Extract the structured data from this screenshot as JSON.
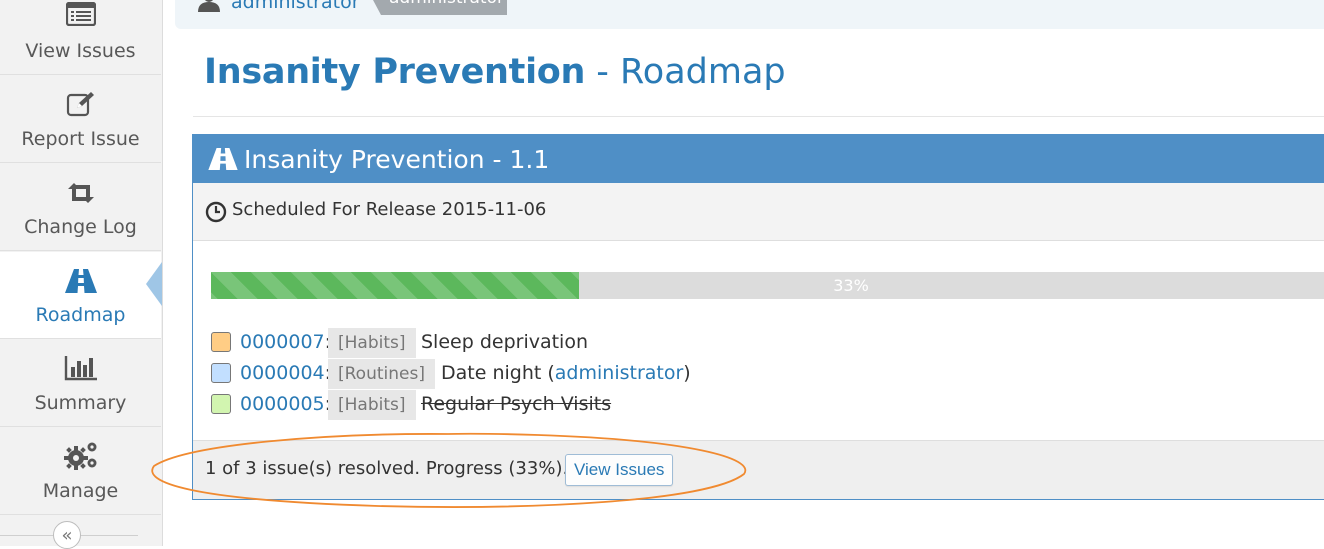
{
  "sidebar": {
    "items": [
      {
        "label": "View Issues",
        "icon": "list-icon"
      },
      {
        "label": "Report Issue",
        "icon": "edit-icon"
      },
      {
        "label": "Change Log",
        "icon": "retweet-icon"
      },
      {
        "label": "Roadmap",
        "icon": "road-icon",
        "active": true
      },
      {
        "label": "Summary",
        "icon": "bar-chart-icon"
      },
      {
        "label": "Manage",
        "icon": "gears-icon"
      }
    ],
    "collapse_glyph": "«"
  },
  "breadcrumb": {
    "user": "administrator",
    "tag": "administrator"
  },
  "page": {
    "project": "Insanity Prevention",
    "separator": " - ",
    "section": "Roadmap"
  },
  "version": {
    "title": "Insanity Prevention - 1.1",
    "scheduled": "Scheduled For Release 2015-11-06",
    "progress_percent": 33,
    "progress_label": "33%",
    "issues": [
      {
        "id": "0000007",
        "status_color": "#ffcd85",
        "category": "[Habits]",
        "summary": "Sleep deprivation",
        "by": "",
        "resolved": false
      },
      {
        "id": "0000004",
        "status_color": "#c2dfff",
        "category": "[Routines]",
        "summary": "Date night (",
        "by": "administrator",
        "summary_end": ")",
        "resolved": false
      },
      {
        "id": "0000005",
        "status_color": "#d2f5b0",
        "category": "[Habits]",
        "summary": "Regular Psych Visits",
        "by": "",
        "resolved": true
      }
    ],
    "footer_text": "1 of 3 issue(s) resolved. Progress (33%).",
    "view_issues_label": "View Issues"
  },
  "colors": {
    "accent": "#2a7ab5",
    "header": "#4f8fc6",
    "progress": "#5cb85c",
    "annotation": "#f08a30"
  }
}
